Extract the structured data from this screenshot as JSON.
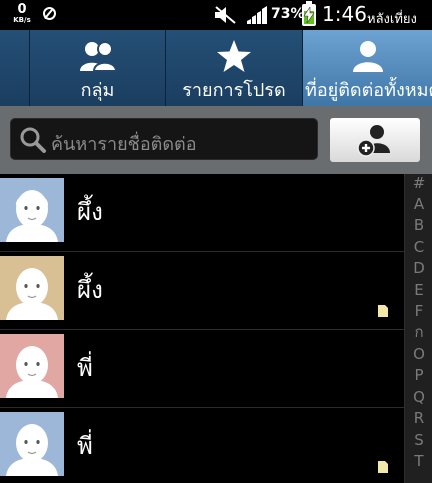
{
  "status_bar": {
    "data_rate": "0",
    "data_unit": "KB/s",
    "battery_percent": "73%",
    "battery_level": 0.73,
    "time": "1:46",
    "am_pm": "หลังเที่ยง"
  },
  "tabs": [
    {
      "label": "กลุ่ม",
      "icon": "group-icon"
    },
    {
      "label": "รายการโปรด",
      "icon": "star-icon"
    },
    {
      "label": "ที่อยู่ติดต่อทั้งหมด",
      "icon": "person-icon",
      "active": true
    }
  ],
  "search": {
    "placeholder": "ค้นหารายชื่อติดต่อ"
  },
  "add_contact_icon": "add-contact-icon",
  "contacts": [
    {
      "name": "ผึ้ง",
      "avatar_color": "#9cb7d8",
      "sim": false
    },
    {
      "name": "ผึ้ง",
      "avatar_color": "#d8bf94",
      "sim": true
    },
    {
      "name": "พี่",
      "avatar_color": "#e0a7a3",
      "sim": false
    },
    {
      "name": "พี่",
      "avatar_color": "#9cb7d8",
      "sim": true
    }
  ],
  "index_letters": [
    "#",
    "A",
    "B",
    "C",
    "D",
    "E",
    "F",
    "ก",
    "O",
    "P",
    "Q",
    "R",
    "S",
    "T"
  ],
  "colors": {
    "tab_bg": "#1b3f63",
    "tab_active": "#5a93c5",
    "battery_fill": "#5ec21b"
  }
}
